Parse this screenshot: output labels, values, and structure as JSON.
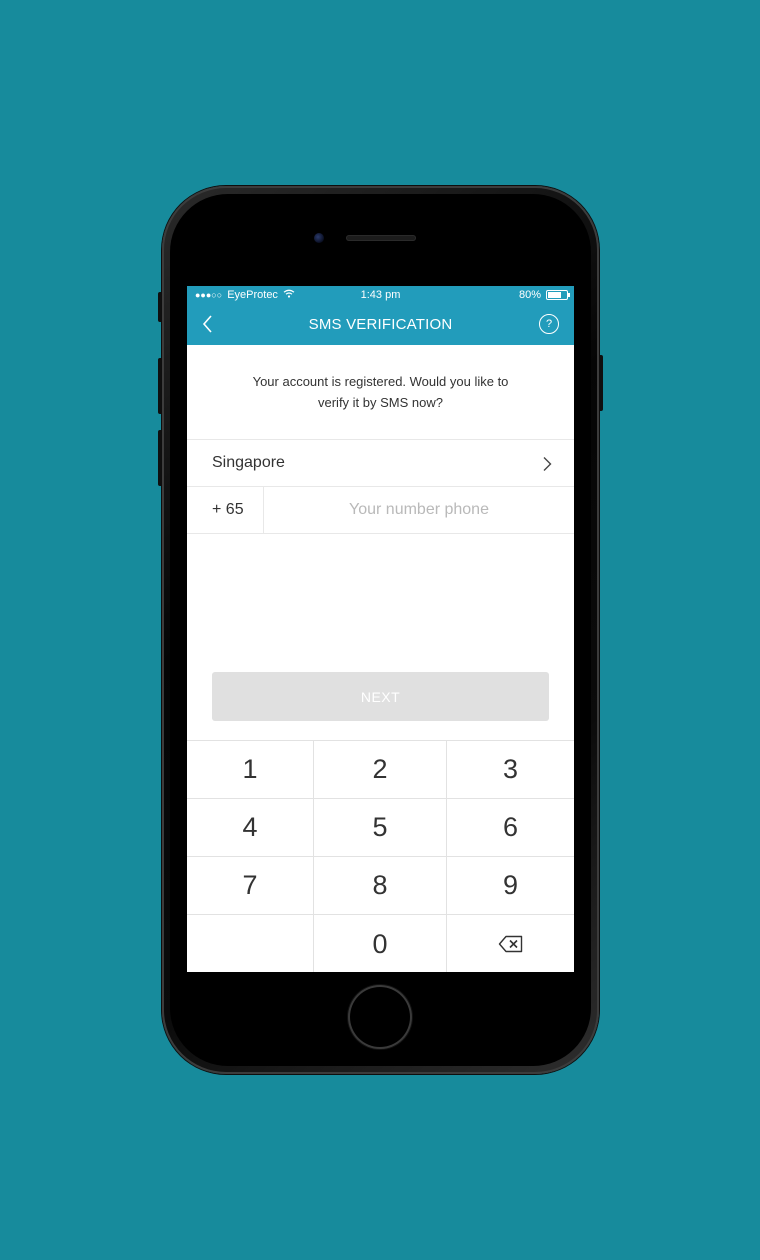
{
  "status_bar": {
    "signal": "●●●○○",
    "carrier": "EyeProtec",
    "wifi_icon": "wifi-icon",
    "time": "1:43 pm",
    "battery_percent": "80%",
    "battery_level": 0.8
  },
  "nav": {
    "title": "SMS VERIFICATION",
    "back_icon": "chevron-left-icon",
    "help_label": "?"
  },
  "message": "Your account is registered. Would you like to verify it by SMS now?",
  "country": {
    "label": "Singapore",
    "icon": "chevron-right-icon"
  },
  "phone": {
    "code": "+ 65",
    "placeholder": "Your number phone",
    "value": ""
  },
  "next_button": {
    "label": "NEXT",
    "color": "#e0e0e0"
  },
  "keypad": {
    "keys": [
      "1",
      "2",
      "3",
      "4",
      "5",
      "6",
      "7",
      "8",
      "9",
      "",
      "0",
      ""
    ],
    "backspace_icon": "backspace-icon"
  },
  "colors": {
    "background": "#178b9c",
    "accent": "#229cbb"
  }
}
